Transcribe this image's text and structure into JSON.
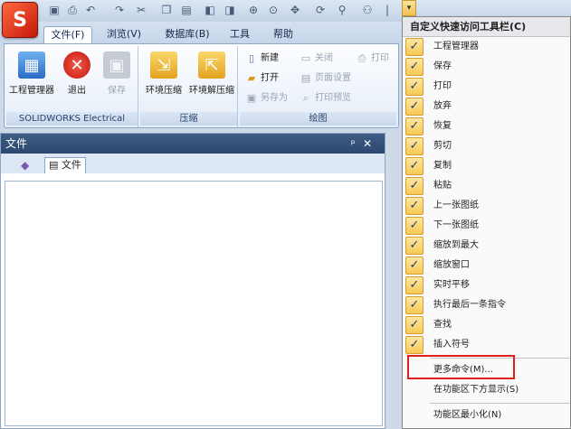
{
  "qat": {
    "icons": [
      "save-icon",
      "print-icon",
      "undo-icon",
      "redo-icon",
      "cut-icon",
      "copy-icon",
      "paste-icon",
      "previous-sheet-icon",
      "next-sheet-icon",
      "zoom-fit-icon",
      "zoom-window-icon",
      "pan-icon",
      "repeat-command-icon",
      "find-icon",
      "insert-symbol-icon"
    ],
    "dropdown": "▾"
  },
  "app_logo": "S",
  "tabs": [
    "文件(F)",
    "浏览(V)",
    "数据库(B)",
    "工具",
    "帮助"
  ],
  "ribbon": {
    "groups": [
      {
        "label": "SOLIDWORKS Electrical",
        "buttons": [
          "工程管理器",
          "退出",
          "保存"
        ]
      },
      {
        "label": "压缩",
        "buttons": [
          "环境压缩",
          "环境解压缩"
        ]
      },
      {
        "label": "绘图",
        "small": [
          "新建",
          "打开",
          "另存为",
          "关闭",
          "页面设置",
          "打印预览",
          "打印"
        ]
      }
    ]
  },
  "panel": {
    "title": "文件",
    "pin": "ᵖ",
    "close": "✕",
    "tab": "文件"
  },
  "menu": {
    "title": "自定义快速访问工具栏(C)",
    "items": [
      "工程管理器",
      "保存",
      "打印",
      "放弃",
      "恢复",
      "剪切",
      "复制",
      "粘贴",
      "上一张图纸",
      "下一张图纸",
      "缩放到最大",
      "缩放窗口",
      "实时平移",
      "执行最后一条指令",
      "查找",
      "插入符号"
    ],
    "check": "✓",
    "more": "更多命令(M)...",
    "show_below": "在功能区下方显示(S)",
    "minimize": "功能区最小化(N)"
  },
  "colors": {
    "highlight_box": "#e0201a",
    "check_bg": "#f7c955",
    "title_bar": "#2c4870"
  }
}
